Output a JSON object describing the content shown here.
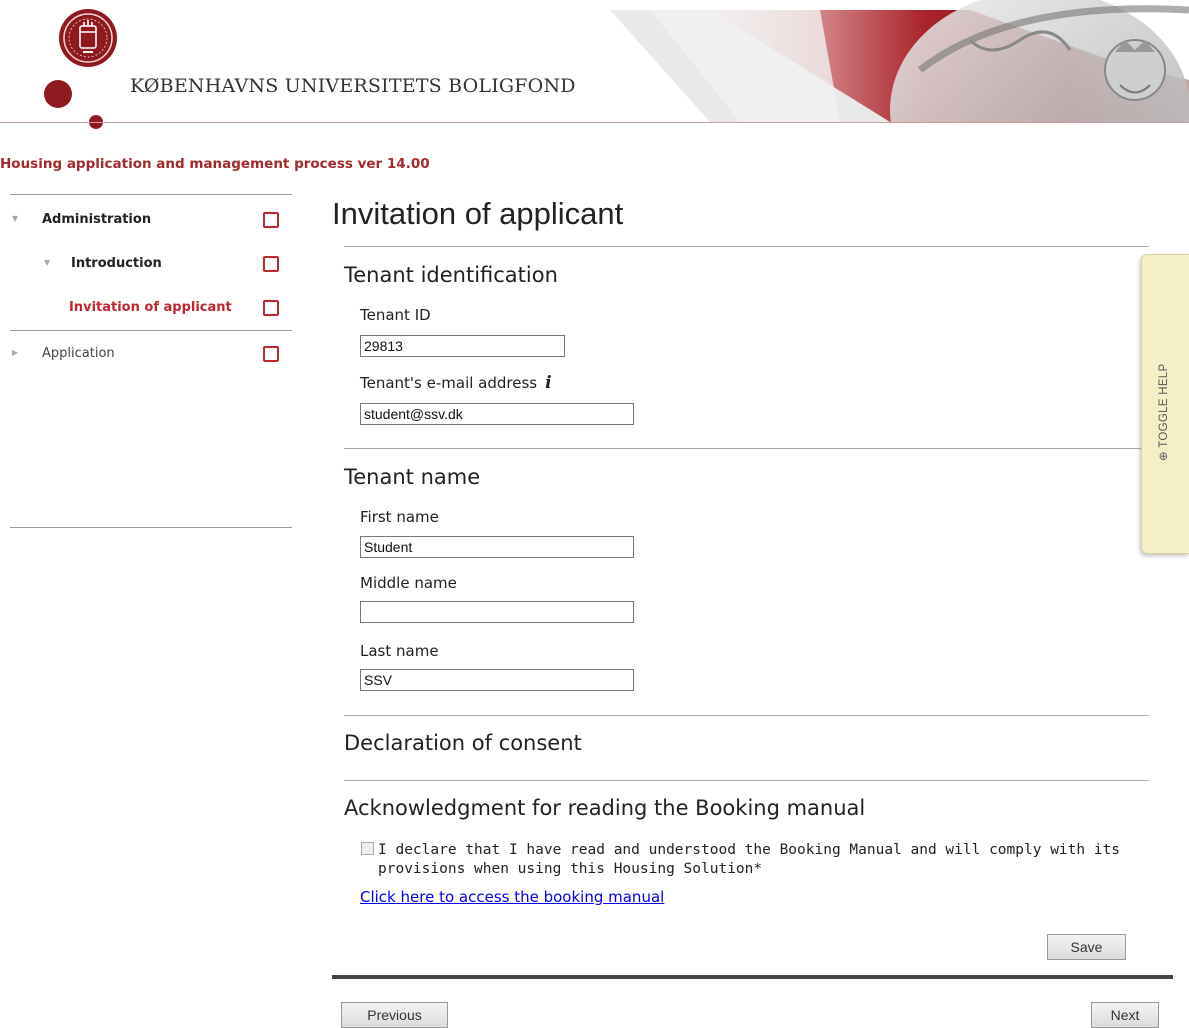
{
  "header": {
    "org_name": "KØBENHAVNS UNIVERSITETS BOLIGFOND",
    "app_title": "Housing application and management process ver 14.00",
    "brand_color": "#8e1a1f"
  },
  "sidebar": {
    "items": [
      {
        "label": "Administration",
        "level": 0,
        "expanded": true,
        "active": false
      },
      {
        "label": "Introduction",
        "level": 1,
        "expanded": true,
        "active": false
      },
      {
        "label": "Invitation of applicant",
        "level": 2,
        "expanded": false,
        "active": true
      },
      {
        "label": "Application",
        "level": 0,
        "expanded": false,
        "active": false
      }
    ]
  },
  "main": {
    "page_title": "Invitation of applicant",
    "sections": {
      "tenant_identification": {
        "title": "Tenant identification",
        "tenant_id_label": "Tenant ID",
        "tenant_id_value": "29813",
        "email_label": "Tenant's e-mail address",
        "email_value": "student@ssv.dk",
        "info_icon": "i"
      },
      "tenant_name": {
        "title": "Tenant name",
        "first_name_label": "First name",
        "first_name_value": "Student",
        "middle_name_label": "Middle name",
        "middle_name_value": "",
        "last_name_label": "Last name",
        "last_name_value": "SSV"
      },
      "declaration": {
        "title": "Declaration of consent"
      },
      "acknowledgment": {
        "title": "Acknowledgment for reading the Booking manual",
        "checkbox_checked": false,
        "checkbox_text": "I declare that I have read and understood the Booking Manual and will comply with its provisions when using this Housing Solution*",
        "link_text": "Click here to access the booking manual"
      }
    },
    "buttons": {
      "save": "Save",
      "previous": "Previous",
      "next": "Next"
    }
  },
  "help_tab": {
    "label": "⊕ TOGGLE HELP"
  },
  "colors": {
    "accent_red": "#c0272d",
    "title_red": "#a12a2a",
    "link_blue": "#0000ee",
    "help_bg": "#f4efc7"
  }
}
